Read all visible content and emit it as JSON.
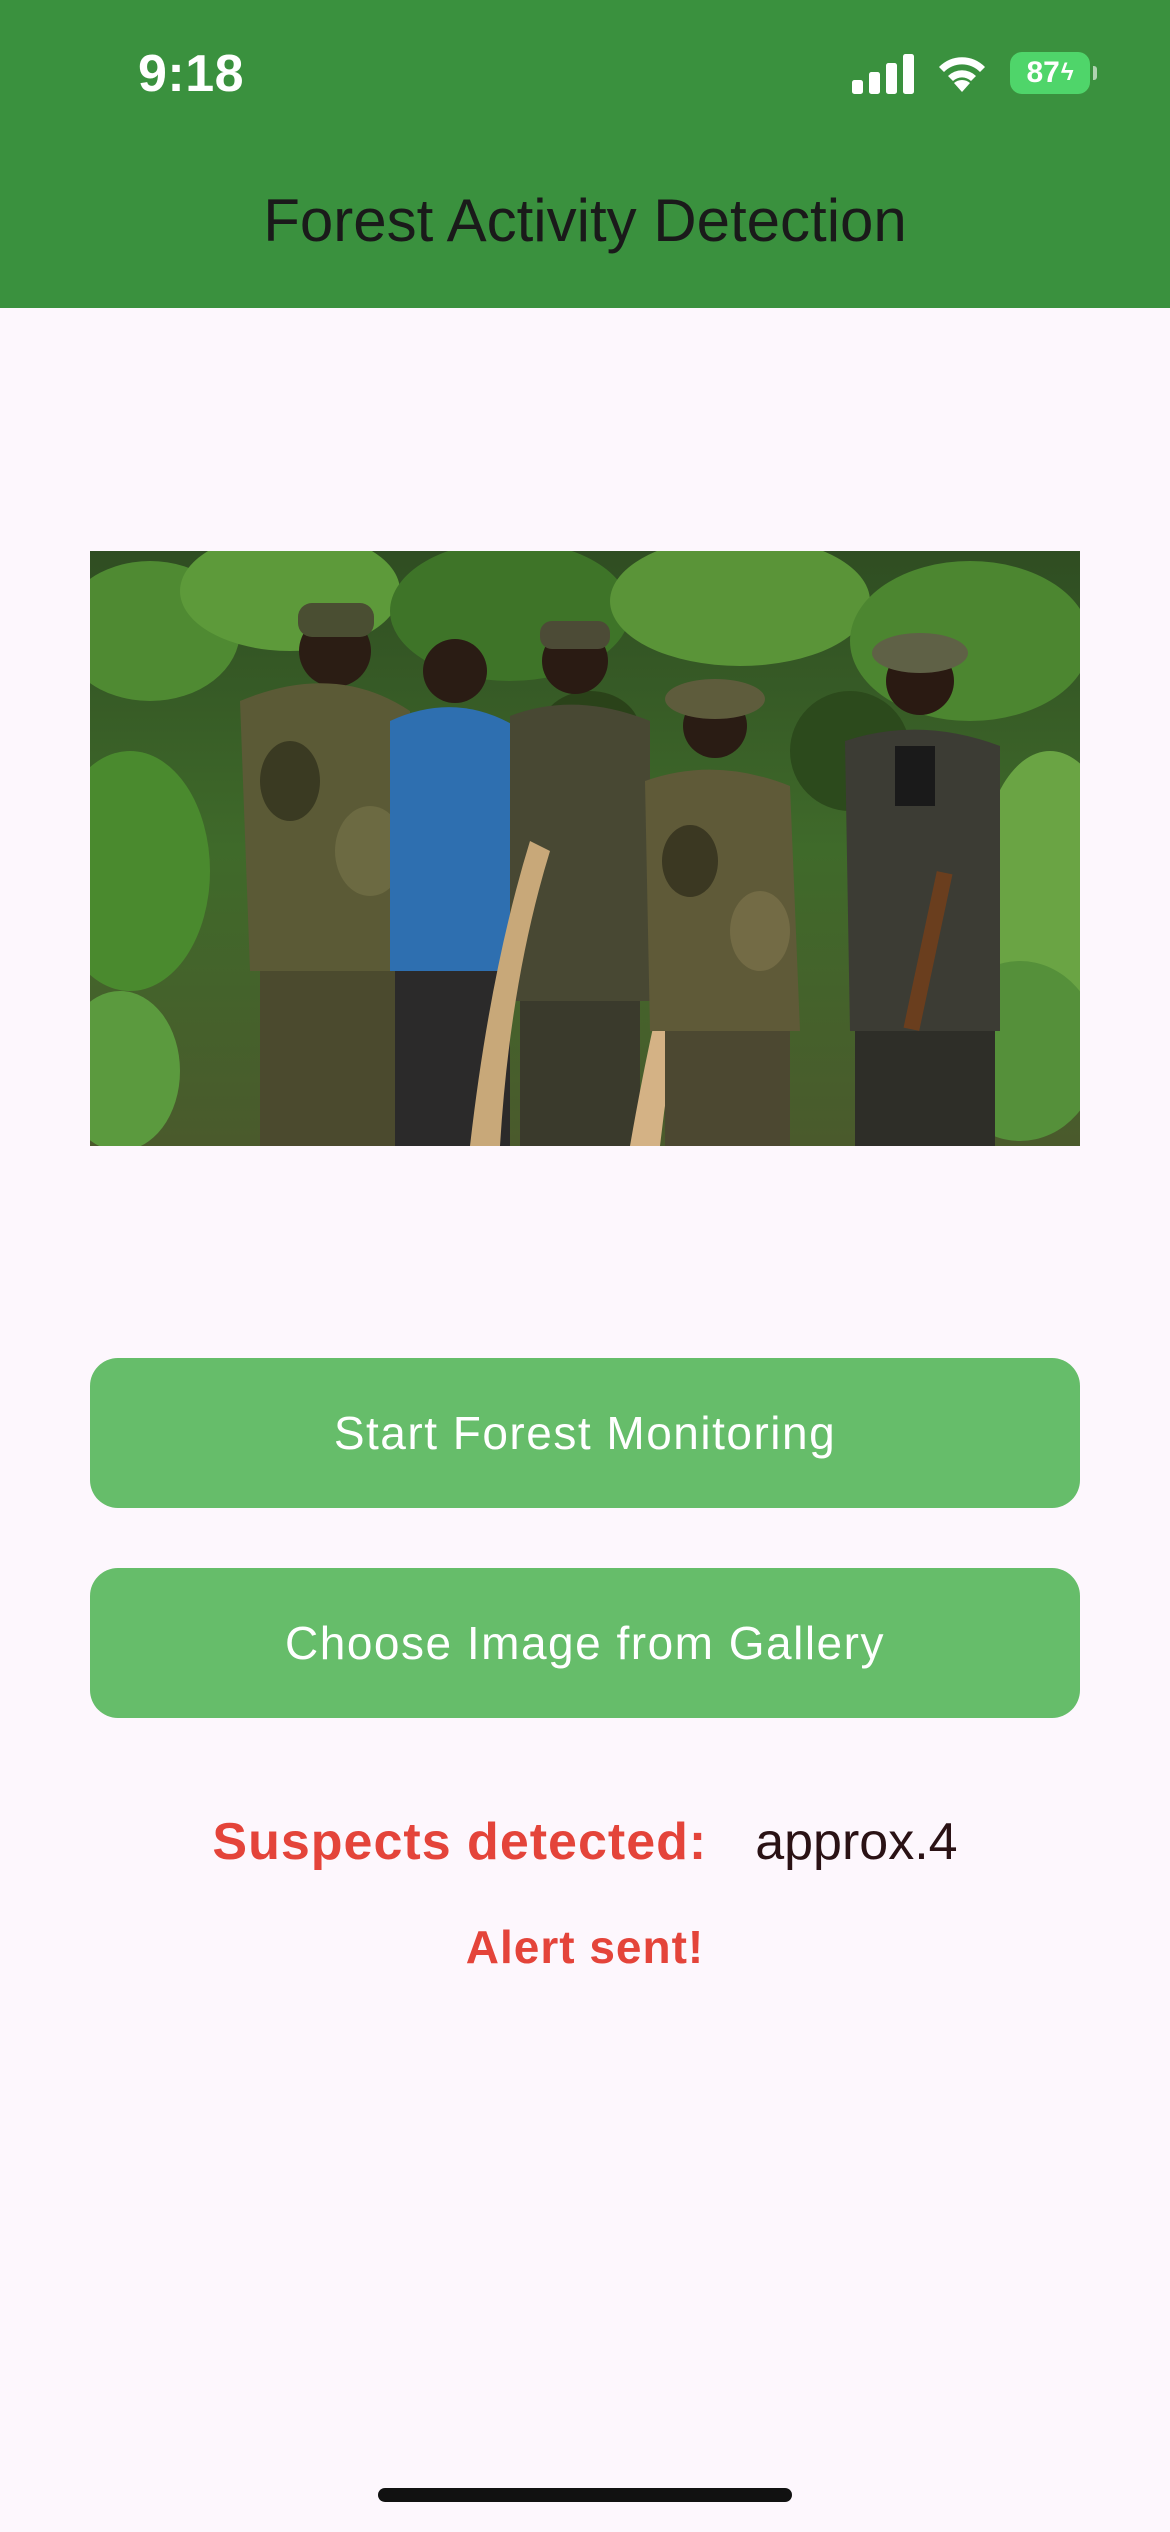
{
  "status_bar": {
    "time": "9:18",
    "battery": "87",
    "icons": [
      "signal-icon",
      "wifi-icon",
      "battery-icon"
    ]
  },
  "app_bar": {
    "title": "Forest Activity Detection",
    "color": "#3a913e"
  },
  "image": {
    "description_icon": "forest-photo"
  },
  "buttons": {
    "start_monitoring": "Start Forest Monitoring",
    "choose_gallery": "Choose Image from Gallery",
    "color": "#66bd6a"
  },
  "result": {
    "label": "Suspects detected:",
    "value": "approx.4",
    "alert": "Alert sent!",
    "alert_color": "#e4443a"
  }
}
